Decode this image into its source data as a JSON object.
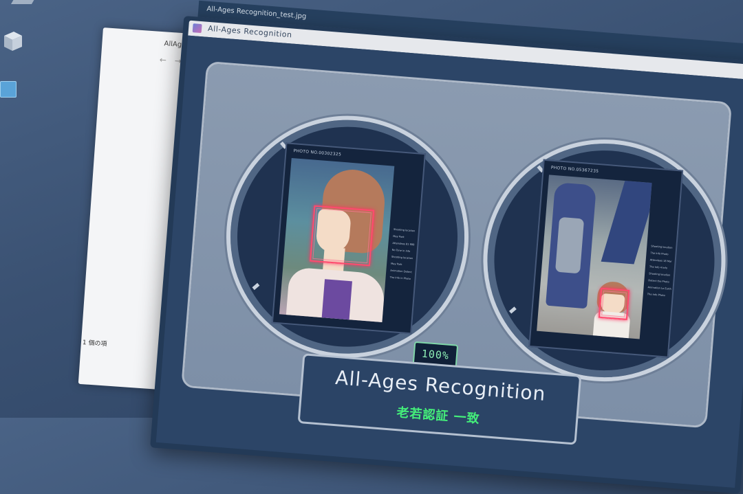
{
  "desktop": {
    "icons": [
      "cube-icon",
      "document-icon"
    ]
  },
  "background_window": {
    "title": "AllAg",
    "nav": "← →",
    "status": "1 個の項"
  },
  "window": {
    "file_title": "All-Ages Recognition_test.jpg",
    "app_title": "All-Ages Recognition"
  },
  "left_photo": {
    "photo_id": "PHOTO NO.00302325",
    "info_lines": [
      "Shooting location",
      "May Park",
      "Attendees 81 999",
      "No Tone in Info",
      "Shooting location",
      "May Park",
      "Animation Detect",
      "The Info in Photo"
    ]
  },
  "right_photo": {
    "photo_id": "PHOTO NO.05367235",
    "info_lines": [
      "Shooting location",
      "The Info Photo",
      "Attendees 18 Mar",
      "The Info 4 Info",
      "Shooting location",
      "Detect the Photo",
      "Animation Lo Earth",
      "The Info Photo"
    ]
  },
  "result": {
    "match_percent": "100%",
    "title": "All-Ages Recognition",
    "subtitle": "老若認証 一致"
  },
  "colors": {
    "accent_green": "#44ef7a",
    "face_box": "#ff4a6e",
    "panel": "#8b9bb0",
    "frame": "#233a57"
  }
}
